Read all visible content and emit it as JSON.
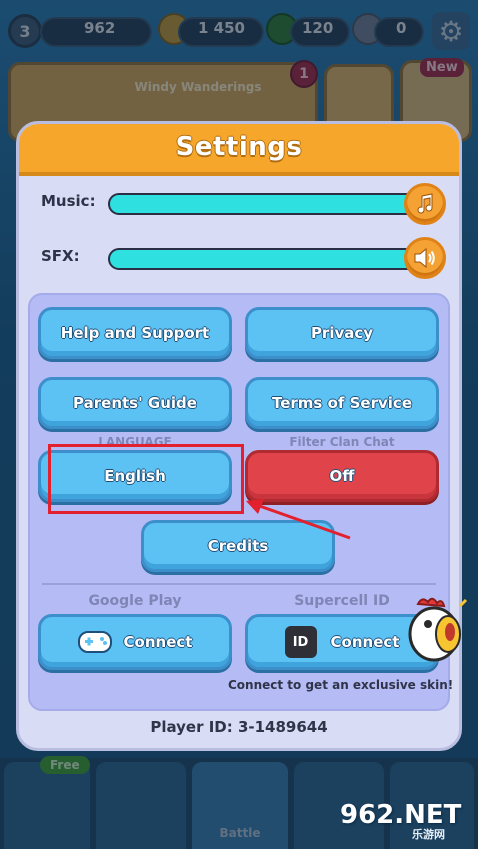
{
  "hud": {
    "level": "3",
    "resources": [
      {
        "name": "trophies",
        "value": "962"
      },
      {
        "name": "coins",
        "value": "1 450"
      },
      {
        "name": "gems",
        "value": "120"
      },
      {
        "name": "stars",
        "value": "0"
      }
    ],
    "event": {
      "title": "Windy Wanderings",
      "badge": "1"
    },
    "new_badge": "New"
  },
  "bottom_nav": {
    "free_badge": "Free",
    "battle_label": "Battle"
  },
  "settings": {
    "title": "Settings",
    "music_label": "Music:",
    "sfx_label": "SFX:",
    "music_level": 1.0,
    "sfx_level": 1.0,
    "help_label": "Help and Support",
    "privacy_label": "Privacy",
    "parents_label": "Parents' Guide",
    "terms_label": "Terms of Service",
    "language_heading": "LANGUAGE",
    "filter_heading": "Filter Clan Chat",
    "language_value": "English",
    "filter_value": "Off",
    "credits_label": "Credits",
    "google_heading": "Google Play",
    "supercell_heading": "Supercell ID",
    "google_connect": "Connect",
    "supercell_connect": "Connect",
    "skin_note": "Connect to get an exclusive skin!",
    "player_id": "Player ID: 3-1489644"
  },
  "colors": {
    "header": "#f6a72b",
    "button": "#5cc2f4",
    "button_red": "#e0434a",
    "slider_fill": "#2fe0e0",
    "highlight": "#e3212e"
  },
  "watermark": {
    "brand": "962.NET",
    "sub": "乐游网"
  }
}
